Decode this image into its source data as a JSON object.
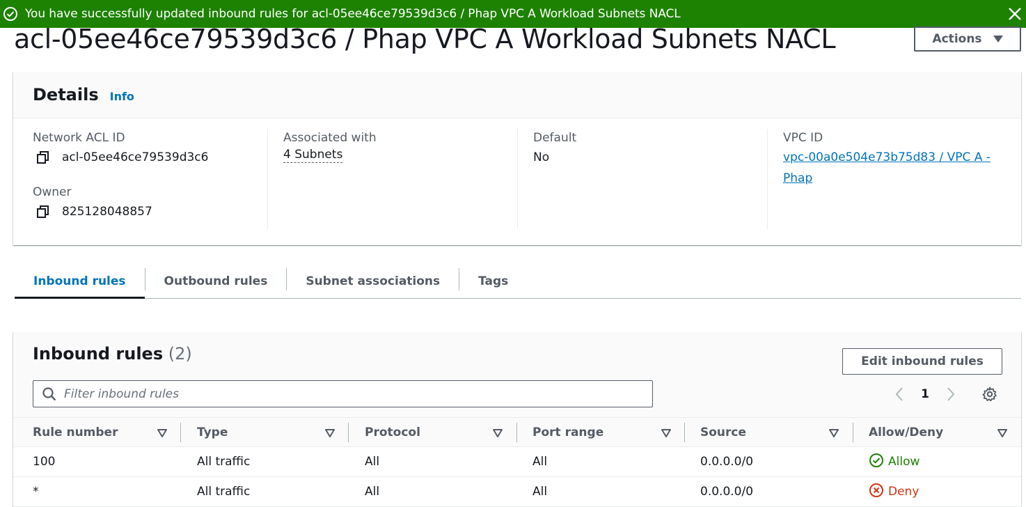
{
  "flash": {
    "message": "You have successfully updated inbound rules for acl-05ee46ce79539d3c6 / Phap VPC A Workload Subnets NACL",
    "color": "#1d8102"
  },
  "page": {
    "title": "acl-05ee46ce79539d3c6 / Phap VPC A Workload Subnets NACL",
    "actions_label": "Actions"
  },
  "details": {
    "title": "Details",
    "info_label": "Info",
    "network_acl_id": {
      "label": "Network ACL ID",
      "value": "acl-05ee46ce79539d3c6"
    },
    "owner": {
      "label": "Owner",
      "value": "825128048857"
    },
    "associated_with": {
      "label": "Associated with",
      "value": "4 Subnets"
    },
    "default": {
      "label": "Default",
      "value": "No"
    },
    "vpc_id": {
      "label": "VPC ID",
      "value": "vpc-00a0e504e73b75d83 / VPC A - Phap"
    }
  },
  "tabs": [
    {
      "label": "Inbound rules",
      "active": true
    },
    {
      "label": "Outbound rules",
      "active": false
    },
    {
      "label": "Subnet associations",
      "active": false
    },
    {
      "label": "Tags",
      "active": false
    }
  ],
  "rules": {
    "title": "Inbound rules",
    "count": "(2)",
    "edit_label": "Edit inbound rules",
    "filter_placeholder": "Filter inbound rules",
    "page_number": "1",
    "columns": [
      "Rule number",
      "Type",
      "Protocol",
      "Port range",
      "Source",
      "Allow/Deny"
    ],
    "rows": [
      {
        "rule_number": "100",
        "type": "All traffic",
        "protocol": "All",
        "port_range": "All",
        "source": "0.0.0.0/0",
        "action": "Allow",
        "status_icon": "check-circle-icon"
      },
      {
        "rule_number": "*",
        "type": "All traffic",
        "protocol": "All",
        "port_range": "All",
        "source": "0.0.0.0/0",
        "action": "Deny",
        "status_icon": "x-circle-icon"
      }
    ]
  },
  "colors": {
    "link": "#0073bb",
    "allow": "#1d8102",
    "deny": "#d13212"
  }
}
